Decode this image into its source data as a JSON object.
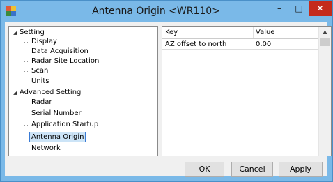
{
  "window": {
    "title": "Antenna Origin <WR110>",
    "controls": {
      "minimize": "–",
      "maximize": "□",
      "close": "✕"
    }
  },
  "tree": {
    "groups": [
      {
        "label": "Setting",
        "expanded": true,
        "children": [
          "Display",
          "Data Acquisition",
          "Radar Site Location",
          "Scan",
          "Units"
        ]
      },
      {
        "label": "Advanced Setting",
        "expanded": true,
        "children": [
          "Radar",
          "Serial Number",
          "Application Startup",
          "Antenna Origin",
          "Network"
        ]
      }
    ],
    "selected": "Antenna Origin"
  },
  "grid": {
    "columns": [
      "Key",
      "Value"
    ],
    "rows": [
      {
        "key": "AZ offset to north",
        "value": "0.00"
      }
    ]
  },
  "buttons": {
    "ok": "OK",
    "cancel": "Cancel",
    "apply": "Apply"
  },
  "colors": {
    "titlebar": "#7ab9e8",
    "close": "#c42b1c",
    "selection": "#cce4f7"
  }
}
